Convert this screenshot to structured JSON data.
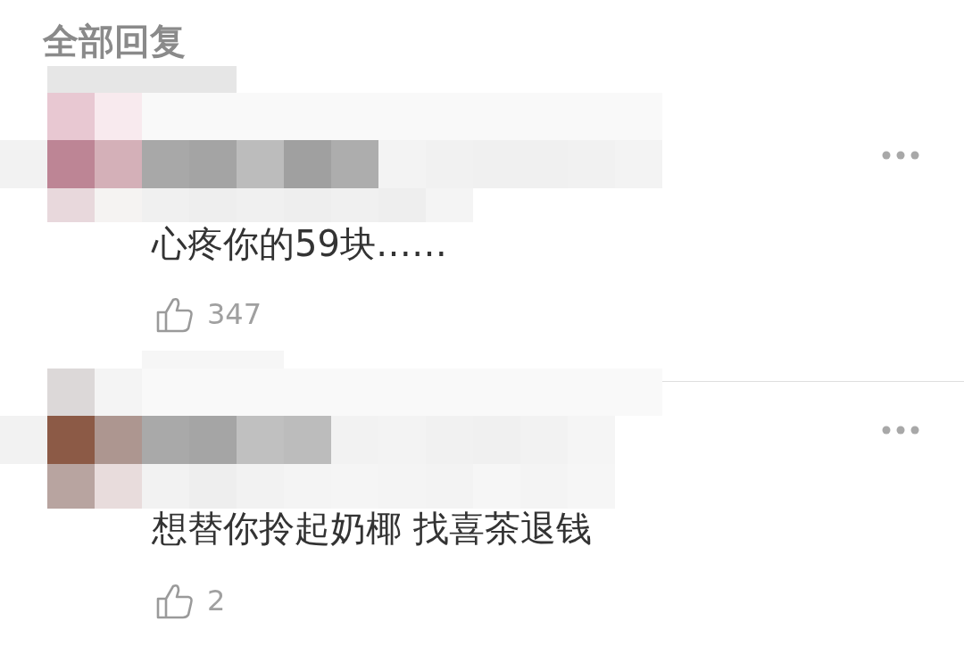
{
  "title": "全部回复",
  "comments": [
    {
      "text": "心疼你的59块……",
      "likes": "347"
    },
    {
      "text": "想替你拎起奶椰 找喜茶退钱",
      "likes": "2"
    }
  ]
}
